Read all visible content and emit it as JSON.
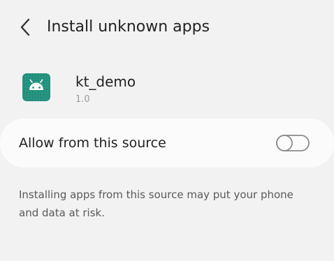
{
  "header": {
    "back_icon": "chevron-left-icon",
    "title": "Install unknown apps"
  },
  "app": {
    "icon": "android-app-icon",
    "icon_color": "#1f8f7b",
    "name": "kt_demo",
    "version": "1.0"
  },
  "setting": {
    "label": "Allow from this source",
    "toggle_icon": "toggle-switch-icon",
    "enabled": false
  },
  "warning": {
    "text": "Installing apps from this source may put your phone and data at risk."
  },
  "colors": {
    "background": "#f2f2f2",
    "card": "#fbfbfb",
    "primary_text": "#222222",
    "secondary_text": "#595959",
    "toggle_off": "#8a8a8a"
  }
}
